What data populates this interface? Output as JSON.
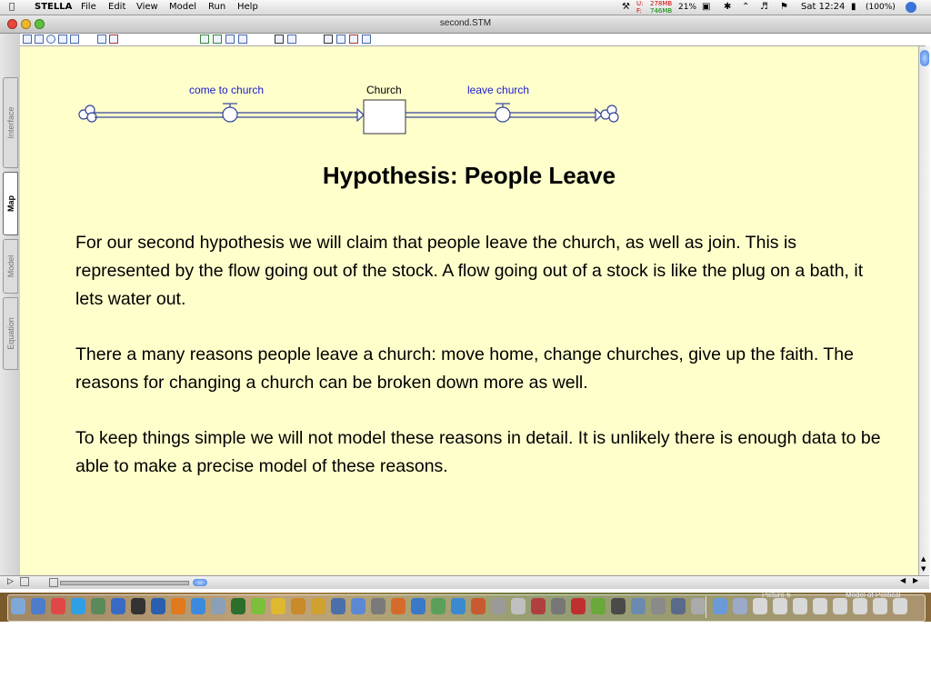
{
  "menubar": {
    "app_name": "STELLA",
    "menus": [
      "File",
      "Edit",
      "View",
      "Model",
      "Run",
      "Help"
    ],
    "memory_top": "278MB",
    "memory_bottom": "746MB",
    "cpu_percent": "21%",
    "clock": "Sat 12:24",
    "battery": "(100%)"
  },
  "window": {
    "title": "second.STM"
  },
  "tabs": [
    "Interface",
    "Map",
    "Model",
    "Equation"
  ],
  "active_tab": "Map",
  "diagram": {
    "stock_label": "Church",
    "inflow_label": "come to church",
    "outflow_label": "leave church"
  },
  "slide": {
    "heading": "Hypothesis: People Leave",
    "paragraphs": [
      "For our second hypothesis we will claim that people leave the church, as well as join. This is represented by the flow going out of the stock. A flow going out of a stock is like the plug on a bath, it lets water out.",
      "There a many reasons people leave a church: move home, change churches, give up the faith. The reasons for changing a church can be broken down more as well.",
      "To keep things simple we will not model these reasons in detail. It is unlikely there is enough data to be able to make a precise model of these reasons."
    ]
  },
  "dock": {
    "label_1": "Picture 6",
    "label_2": "Model of Political"
  },
  "colors": {
    "canvas": "#ffffcc",
    "flow_label": "#1a1acc",
    "diagram_line": "#334499"
  }
}
